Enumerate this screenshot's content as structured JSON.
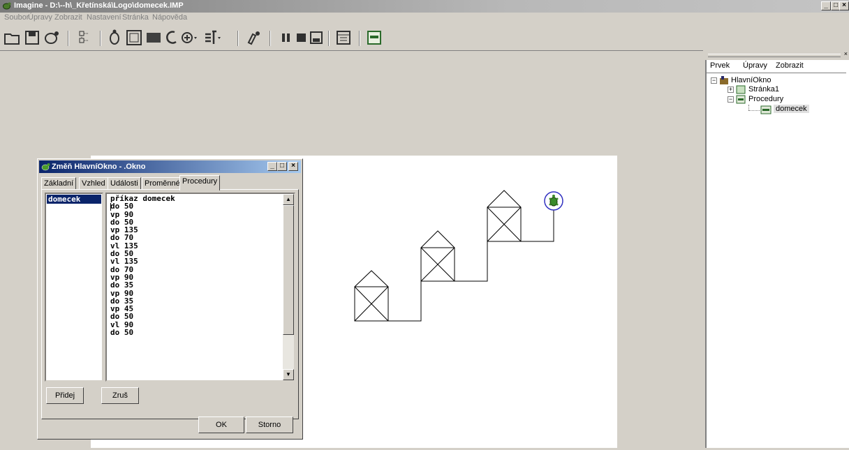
{
  "app": {
    "title": "Imagine - D:\\--h\\_Křetínská\\Logo\\domecek.IMP",
    "controls": [
      "_",
      "□",
      "×"
    ]
  },
  "menu": [
    "Soubor",
    "Úpravy",
    "Zobrazit",
    "Nastavení",
    "Stránka",
    "Nápověda"
  ],
  "toolbar_icons": [
    "open-icon",
    "save-icon",
    "turtle-icon",
    "tree-icon",
    "new-turtle-icon",
    "new-pane-icon",
    "new-shape-icon",
    "pen-icon",
    "button-icon",
    "slider-icon",
    "paint-icon",
    "pause-icon",
    "stop-icon",
    "run-icon",
    "page-icon",
    "procedure-icon"
  ],
  "right_panel": {
    "menu": [
      "Prvek",
      "Úpravy",
      "Zobrazit"
    ],
    "tree": [
      {
        "label": "HlavníOkno",
        "level": 0,
        "icon": "window-icon"
      },
      {
        "label": "Stránka1",
        "level": 1,
        "icon": "page-icon"
      },
      {
        "label": "Procedury",
        "level": 1,
        "icon": "procedures-icon"
      },
      {
        "label": "domecek",
        "level": 2,
        "icon": "procedure-icon",
        "selected": true
      }
    ]
  },
  "dialog": {
    "title": "Změň HlavníOkno - .Okno",
    "tabs": [
      "Základní",
      "Vzhled",
      "Události",
      "Proměnné",
      "Procedury"
    ],
    "active_tab": "Procedury",
    "procedures": [
      "domecek"
    ],
    "code": [
      "příkaz domecek",
      "do 50",
      "vp 90",
      "do 50",
      "vp 135",
      "do 70",
      "vl 135",
      "do 50",
      "vl 135",
      "do 70",
      "vp 90",
      "do 35",
      "vp 90",
      "do 35",
      "vp 45",
      "do 50",
      "vl 90",
      "do 50"
    ],
    "buttons": {
      "add": "Přidej",
      "remove": "Zruš",
      "ok": "OK",
      "cancel": "Storno"
    }
  },
  "colors": {
    "titlebar": "#0a246a",
    "selection": "#0a246a",
    "turtle_ring": "#3030c0",
    "turtle": "#3a8a2a"
  }
}
